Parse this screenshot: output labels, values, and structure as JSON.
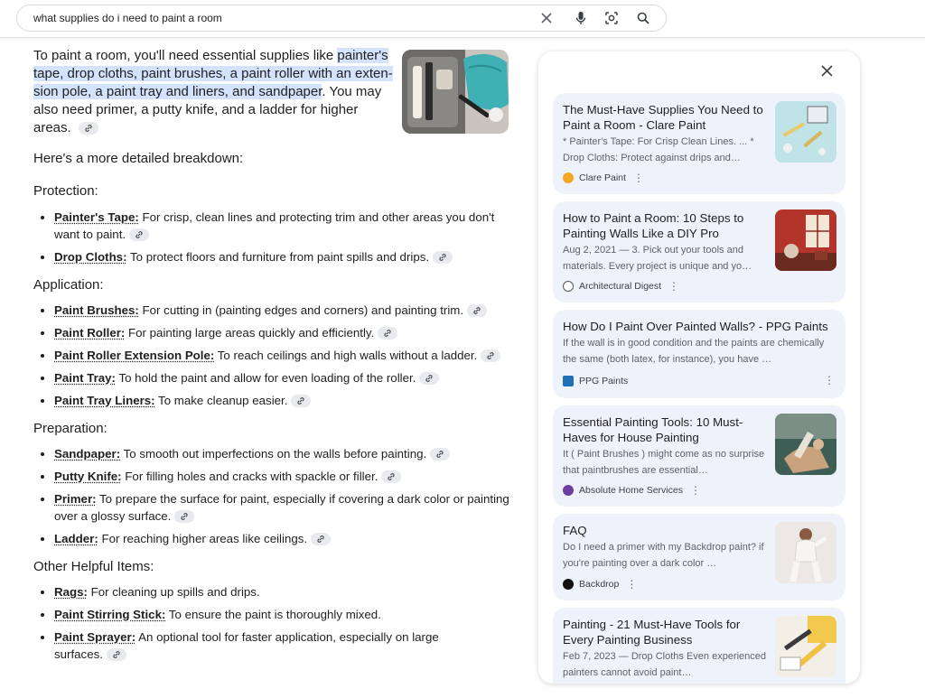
{
  "search": {
    "query": "what supplies do i need to paint a room"
  },
  "answer": {
    "intro_pre": "To paint a room, you'll need essential supplies like ",
    "intro_highlight": "painter's tape, drop cloths, paint brushes, a paint roller with an exten­sion pole, a paint tray and liners, and sandpaper",
    "intro_post": ". You may also need primer, a putty knife, and a ladder for higher areas.",
    "breakdown_label": "Here's a more detailed breakdown:",
    "sections": [
      {
        "heading": "Protection:",
        "items": [
          {
            "term": "Painter's Tape:",
            "desc": " For crisp, clean lines and protecting trim and other areas you don't want to paint."
          },
          {
            "term": "Drop Cloths:",
            "desc": " To protect floors and furniture from paint spills and drips."
          }
        ]
      },
      {
        "heading": "Application:",
        "items": [
          {
            "term": "Paint Brushes:",
            "desc": " For cutting in (painting edges and corners) and painting trim."
          },
          {
            "term": "Paint Roller:",
            "desc": " For painting large areas quickly and efficiently."
          },
          {
            "term": "Paint Roller Extension Pole:",
            "desc": " To reach ceilings and high walls without a ladder."
          },
          {
            "term": "Paint Tray:",
            "desc": " To hold the paint and allow for even loading of the roller."
          },
          {
            "term": "Paint Tray Liners:",
            "desc": " To make cleanup easier."
          }
        ]
      },
      {
        "heading": "Preparation:",
        "items": [
          {
            "term": "Sandpaper:",
            "desc": " To smooth out imperfections on the walls before painting."
          },
          {
            "term": "Putty Knife:",
            "desc": " For filling holes and cracks with spackle or filler."
          },
          {
            "term": "Primer:",
            "desc": " To prepare the surface for paint, especially if covering a dark color or painting over a glossy surface."
          },
          {
            "term": "Ladder:",
            "desc": " For reaching higher areas like ceilings."
          }
        ]
      },
      {
        "heading": "Other Helpful Items:",
        "items": [
          {
            "term": "Rags:",
            "desc": " For cleaning up spills and drips."
          },
          {
            "term": "Paint Stirring Stick:",
            "desc": " To ensure the paint is thoroughly mixed."
          },
          {
            "term": "Paint Sprayer:",
            "desc": " An optional tool for faster application, especially on large surfaces."
          }
        ]
      }
    ]
  },
  "sources": [
    {
      "title": "The Must-Have Supplies You Need to Paint a Room - Clare Paint",
      "snippet": "* Painter's Tape: For Crisp Clean Lines. ... * Drop Cloths: Protect against drips and…",
      "site": "Clare Paint",
      "favicon_color": "#f5a623"
    },
    {
      "title": "How to Paint a Room: 10 Steps to Painting Walls Like a DIY Pro",
      "snippet": "Aug 2, 2021 — 3. Pick out your tools and materials. Every project is unique and yo…",
      "site": "Architectural Digest",
      "favicon_color": "#ffffff"
    },
    {
      "title": "How Do I Paint Over Painted Walls? - PPG Paints",
      "snippet": "If the wall is in good condition and the paints are chemically the same (both latex, for instance), you have …",
      "site": "PPG Paints",
      "favicon_color": "#1e6fb5"
    },
    {
      "title": "Essential Painting Tools: 10 Must-Haves for House Painting",
      "snippet": "It ( Paint Brushes ) might come as no surprise that paintbrushes are essential…",
      "site": "Absolute Home Services",
      "favicon_color": "#6b3fa0"
    },
    {
      "title": "FAQ",
      "snippet": "Do I need a primer with my Backdrop paint? if you're painting over a dark color …",
      "site": "Backdrop",
      "favicon_color": "#111111"
    },
    {
      "title": "Painting - 21 Must-Have Tools for Every Painting Business",
      "snippet": "Feb 7, 2023 — Drop Cloths Even experienced painters cannot avoid paint…",
      "site": "",
      "favicon_color": ""
    }
  ],
  "icons": {
    "clear": "close-icon",
    "mic": "microphone-icon",
    "lens": "lens-icon",
    "search": "search-icon",
    "link": "link-icon",
    "more": "more-vert-icon"
  }
}
